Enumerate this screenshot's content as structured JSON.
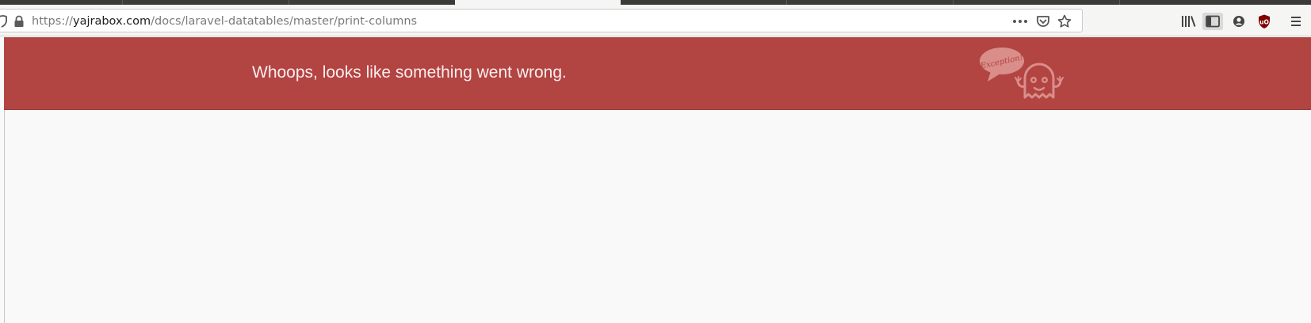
{
  "browser": {
    "url_prefix": "https://",
    "url_domain": "yajrabox.com",
    "url_path": "/docs/laravel-datatables/master/print-columns"
  },
  "icons": {
    "tracking": "shield-icon",
    "security": "lock-icon",
    "page_actions": "more-actions-icon",
    "pocket": "pocket-icon",
    "bookmark": "star-icon",
    "library": "library-icon",
    "sidebar": "sidebar-icon",
    "account": "account-icon",
    "extension": "ublock-icon",
    "menu": "hamburger-menu-icon"
  },
  "page": {
    "error_message": "Whoops, looks like something went wrong.",
    "logo_text": "Exception!"
  },
  "colors": {
    "banner": "#b24442",
    "background": "#f9f9f9",
    "ublock": "#800000"
  }
}
